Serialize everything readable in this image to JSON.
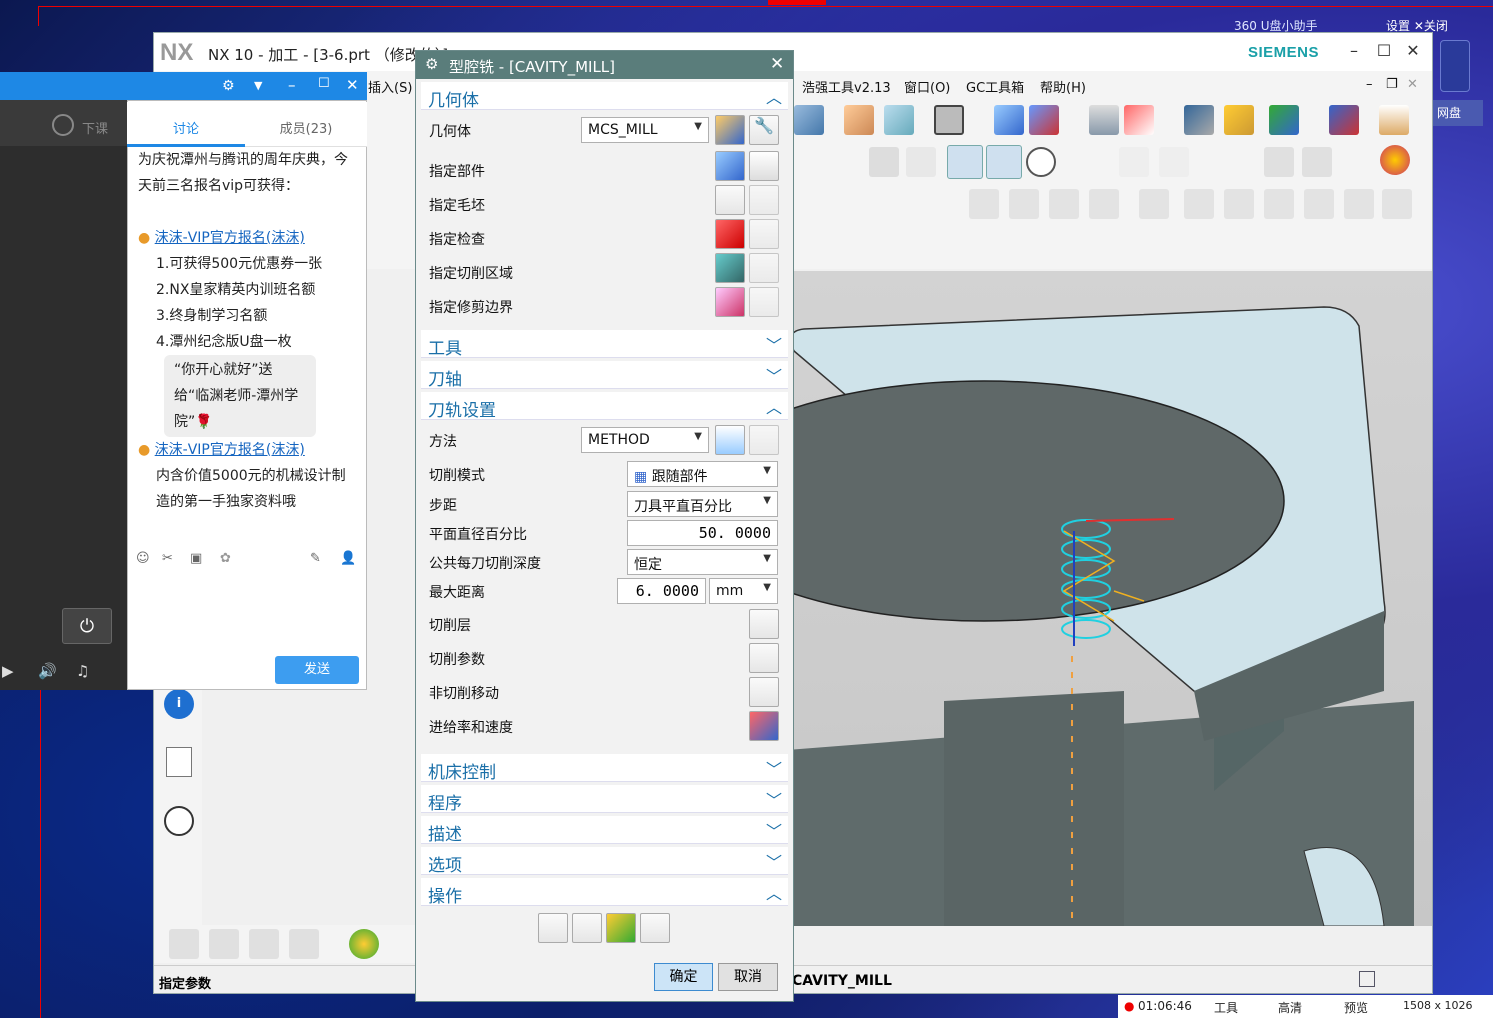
{
  "desktop": {
    "helper": "360 U盘小助手",
    "settings": "设置",
    "close": "关闭",
    "netdisk": "网盘"
  },
  "nx": {
    "logo": "NX",
    "title": "NX 10 - 加工 - [3-6.prt （修改的）]",
    "brand": "SIEMENS",
    "menu": [
      "插入(S)",
      "浩强工具v2.13",
      "窗口(O)",
      "GC工具箱",
      "帮助(H)"
    ],
    "status_text": "指定参数",
    "status_op": "CAVITY_MILL"
  },
  "chat": {
    "tab_discuss": "讨论",
    "tab_members": "成员(23)",
    "left_label": "下课",
    "messages": [
      {
        "type": "text",
        "text": "为庆祝潭州与腾讯的周年庆典，今天前三名报名vip可获得："
      },
      {
        "type": "user",
        "text": "沫沫-VIP官方报名(沫沫)"
      },
      {
        "type": "text",
        "text": "1.可获得500元优惠券一张"
      },
      {
        "type": "text",
        "text": "2.NX皇家精英内训班名额"
      },
      {
        "type": "text",
        "text": "3.终身制学习名额"
      },
      {
        "type": "text",
        "text": "4.潭州纪念版U盘一枚"
      },
      {
        "type": "bubble",
        "text": "“你开心就好”送给“临渊老师-潭州学院”🌹"
      },
      {
        "type": "user",
        "text": "沫沫-VIP官方报名(沫沫)"
      },
      {
        "type": "text",
        "text": "内含价值5000元的机械设计制造的第一手独家资料哦"
      }
    ],
    "send": "发送"
  },
  "dialog": {
    "title": "型腔铣 - [CAVITY_MILL]",
    "sections": {
      "geometry": "几何体",
      "tool": "工具",
      "axis": "刀轴",
      "path": "刀轨设置",
      "machine": "机床控制",
      "program": "程序",
      "desc": "描述",
      "options": "选项",
      "ops": "操作"
    },
    "geometry": {
      "label": "几何体",
      "value": "MCS_MILL",
      "rows": [
        "指定部件",
        "指定毛坯",
        "指定检查",
        "指定切削区域",
        "指定修剪边界"
      ]
    },
    "path": {
      "method_label": "方法",
      "method_value": "METHOD",
      "cut_mode_label": "切削模式",
      "cut_mode_value": "跟随部件",
      "stepover_label": "步距",
      "stepover_value": "刀具平直百分比",
      "percent_label": "平面直径百分比",
      "percent_value": "50. 0000",
      "depth_label": "公共每刀切削深度",
      "depth_value": "恒定",
      "maxdist_label": "最大距离",
      "maxdist_value": "6. 0000",
      "maxdist_unit": "mm",
      "layers": "切削层",
      "params": "切削参数",
      "noncut": "非切削移动",
      "feeds": "进给率和速度"
    },
    "ok": "确定",
    "cancel": "取消"
  },
  "taskbar": {
    "time": "01:06:46",
    "tools": "工具",
    "quality": "高清",
    "preview": "预览",
    "res": "1508 x 1026"
  }
}
